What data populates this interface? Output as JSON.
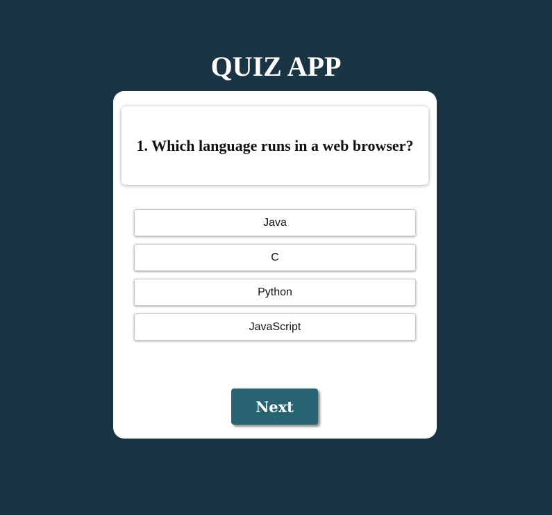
{
  "app": {
    "title": "QUIZ APP"
  },
  "quiz": {
    "question": "1. Which language runs in a web browser?",
    "options": [
      {
        "label": "Java"
      },
      {
        "label": "C"
      },
      {
        "label": "Python"
      },
      {
        "label": "JavaScript"
      }
    ],
    "next_label": "Next"
  },
  "colors": {
    "background": "#1b3444",
    "card": "#ffffff",
    "button": "#296473",
    "button_text": "#ffffff"
  }
}
